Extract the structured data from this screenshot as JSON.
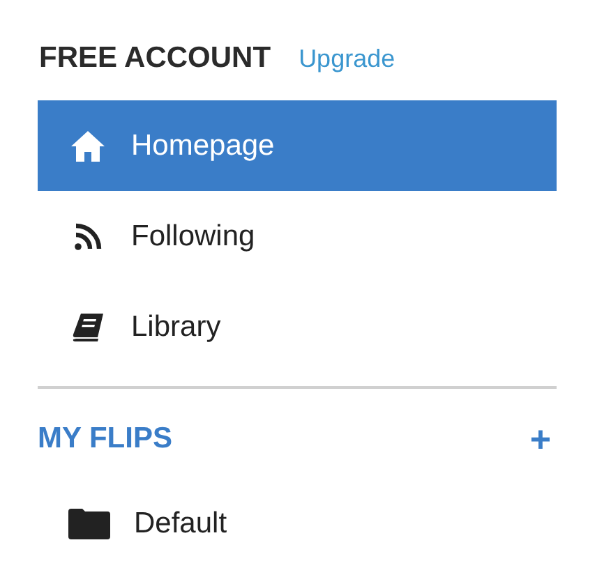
{
  "account": {
    "title": "FREE ACCOUNT",
    "upgrade_link": "Upgrade"
  },
  "nav": [
    {
      "label": "Homepage",
      "selected": true
    },
    {
      "label": "Following",
      "selected": false
    },
    {
      "label": "Library",
      "selected": false
    }
  ],
  "flips": {
    "title": "MY FLIPS",
    "add_button": "+",
    "items": [
      {
        "label": "Default"
      }
    ]
  }
}
